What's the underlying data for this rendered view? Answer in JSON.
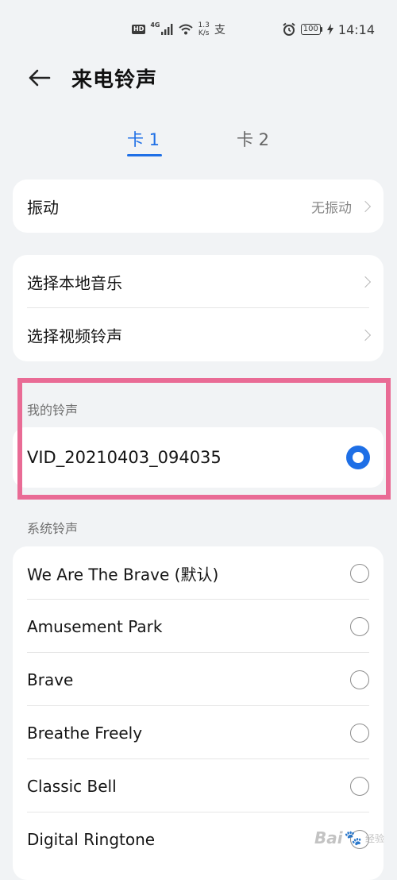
{
  "status_bar": {
    "hd": "HD",
    "network": "4G",
    "speed_value": "1.3",
    "speed_unit": "K/s",
    "pay_glyph": "支",
    "battery": "100",
    "time": "14:14"
  },
  "header": {
    "title": "来电铃声"
  },
  "tabs": [
    {
      "label": "卡 1",
      "selected": true
    },
    {
      "label": "卡 2",
      "selected": false
    }
  ],
  "vibration": {
    "label": "振动",
    "value": "无振动"
  },
  "sources": {
    "items": [
      {
        "label": "选择本地音乐"
      },
      {
        "label": "选择视频铃声"
      }
    ]
  },
  "my_ringtones": {
    "header": "我的铃声",
    "items": [
      {
        "label": "VID_20210403_094035",
        "selected": true
      }
    ]
  },
  "system_ringtones": {
    "header": "系统铃声",
    "items": [
      {
        "label": "We Are The Brave (默认)",
        "selected": false
      },
      {
        "label": "Amusement Park",
        "selected": false
      },
      {
        "label": "Brave",
        "selected": false
      },
      {
        "label": "Breathe Freely",
        "selected": false
      },
      {
        "label": "Classic Bell",
        "selected": false
      },
      {
        "label": "Digital Ringtone",
        "selected": false
      }
    ]
  },
  "watermark": {
    "brand": "Bai",
    "paw": "🐾",
    "suffix": "经验"
  },
  "colors": {
    "accent": "#1e6fe6",
    "highlight": "#e96b95",
    "background": "#f1f3f5"
  }
}
